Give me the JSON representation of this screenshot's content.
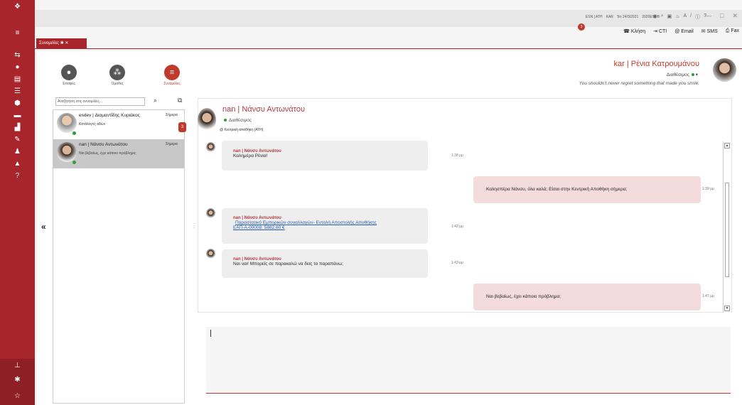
{
  "topbar": {
    "info": [
      "ESN | ATH",
      "KAR",
      "Τετ 24/3/2021",
      "2020ESDB"
    ],
    "badge_count": "3",
    "actions": [
      "Κλήση",
      "CTI",
      "Email",
      "SMS",
      "Fax"
    ]
  },
  "tab": {
    "label": "Συνομιλίες"
  },
  "toggles": [
    {
      "label": "Επαφές"
    },
    {
      "label": "Ομάδες"
    },
    {
      "label": "Συνομιλίες"
    }
  ],
  "search": {
    "placeholder": "Αναζήτηση στις συνομιλίες..."
  },
  "conversations": [
    {
      "name": "esdev | Διαμαντίδης Κυριάκος",
      "sub": "Κατάλογος αδών",
      "time": "Σήμερα",
      "unread": "3"
    },
    {
      "name": "nan | Νάνσυ Αντωνάτου",
      "sub": "Ναι βεβαίως, έχει κάποιο πρόβλημα;",
      "time": "Σήμερα"
    }
  ],
  "user": {
    "name": "kar | Ρένια Κατρουμάνου",
    "status": "Διαθέσιμος",
    "quote": "You shouldn't never regret something that made you smile."
  },
  "chat": {
    "contact_name": "nan | Νάνσυ Αντωνάτου",
    "status": "Διαθέσιμος",
    "location": "@ Κεντρική αποθήκη (ΑΤΗ)",
    "messages": [
      {
        "author": "nan | Νάνσυ Αντωνάτου",
        "text": "Καλημέρα Ρένια!",
        "time": "1:38 μμ"
      },
      {
        "text": "Καλησπέρα Νάνσυ, όλα καλά; Είσαι στην Κεντρική Αποθήκη σήμερα;",
        "time": "1:39 μμ"
      },
      {
        "author": "nan | Νάνσυ Αντωνάτου",
        "link1": "Παραστατικό Εμπορικών συναλλαγών- Εντολή Αποστολής Αποθήκης",
        "link2": "ΕΑΠ-Α-00008: 5882,60 €",
        "time": "1:42 μμ"
      },
      {
        "author": "nan | Νάνσυ Αντωνάτου",
        "text": "Ναι ναι! Μπορείς σε παρακαλώ να δεις το παραπάνω;",
        "time": "1:43 μμ"
      },
      {
        "text": "Ναι βεβαίως, έχει κάποιο πρόβλημα;",
        "time": "1:47 μμ"
      }
    ]
  },
  "colors": {
    "accent": "#a8262b",
    "online": "#2e9c3a",
    "outgoing_bubble": "#f5dcdc"
  }
}
